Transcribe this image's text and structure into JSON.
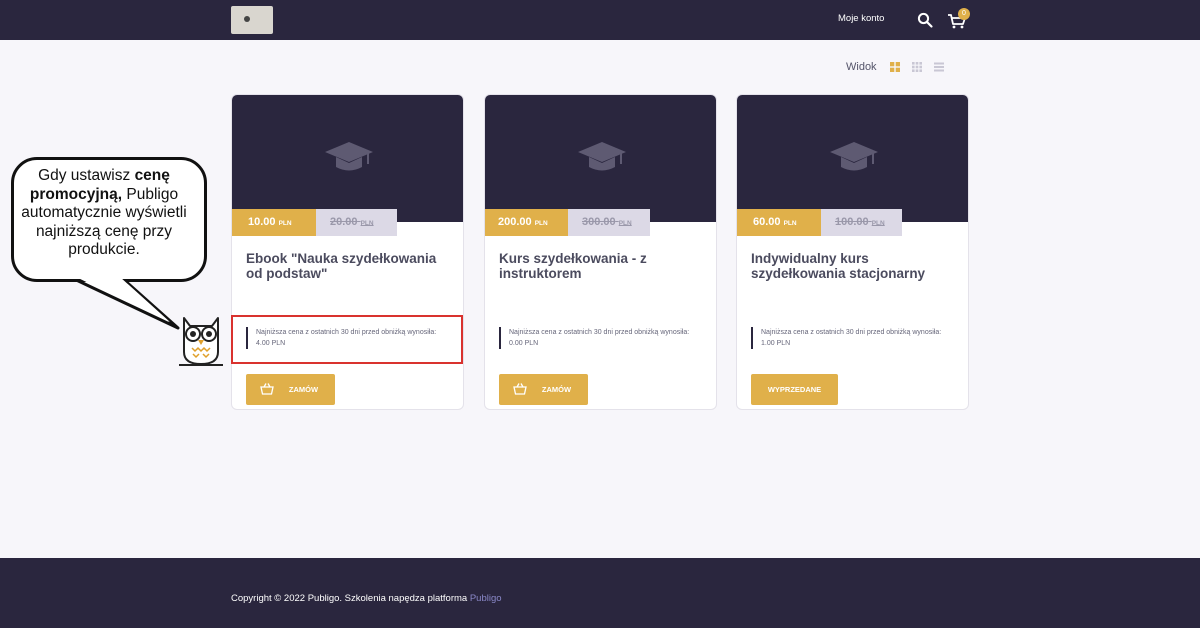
{
  "header": {
    "account_label": "Moje konto",
    "cart_count": "0",
    "search_icon": "search-icon",
    "cart_icon": "cart-icon"
  },
  "view": {
    "label": "Widok",
    "options": [
      "grid-large",
      "grid-small",
      "list"
    ],
    "active": "grid-large"
  },
  "colors": {
    "brand_dark": "#2a263e",
    "accent": "#e0b04a",
    "old_price_bg": "#dcd9e6",
    "highlight": "#d9322e"
  },
  "products": [
    {
      "price_new": "10.00",
      "price_old": "20.00",
      "currency": "PLN",
      "title": "Ebook \"Nauka szydełkowania od podstaw\"",
      "lowest_price_note": "Najniższa cena z ostatnich 30 dni przed obniżką wynosiła: 4.00 PLN",
      "button_label": "ZAMÓW",
      "button_icon": "basket-icon"
    },
    {
      "price_new": "200.00",
      "price_old": "300.00",
      "currency": "PLN",
      "title": "Kurs szydełkowania - z instruktorem",
      "lowest_price_note": "Najniższa cena z ostatnich 30 dni przed obniżką wynosiła: 0.00 PLN",
      "button_label": "ZAMÓW",
      "button_icon": "basket-icon"
    },
    {
      "price_new": "60.00",
      "price_old": "100.00",
      "currency": "PLN",
      "title": "Indywidualny kurs szydełkowania stacjonarny",
      "lowest_price_note": "Najniższa cena z ostatnich 30 dni przed obniżką wynosiła: 1.00 PLN",
      "button_label": "WYPRZEDANE",
      "button_icon": ""
    }
  ],
  "callout": {
    "text_before": "Gdy ustawisz ",
    "text_bold": "cenę promocyjną,",
    "text_after": " Publigo automatycznie wyświetli najniższą cenę przy produkcie."
  },
  "footer": {
    "copyright_text": "Copyright © 2022 Publigo. Szkolenia napędza platforma ",
    "link_text": "Publigo"
  }
}
